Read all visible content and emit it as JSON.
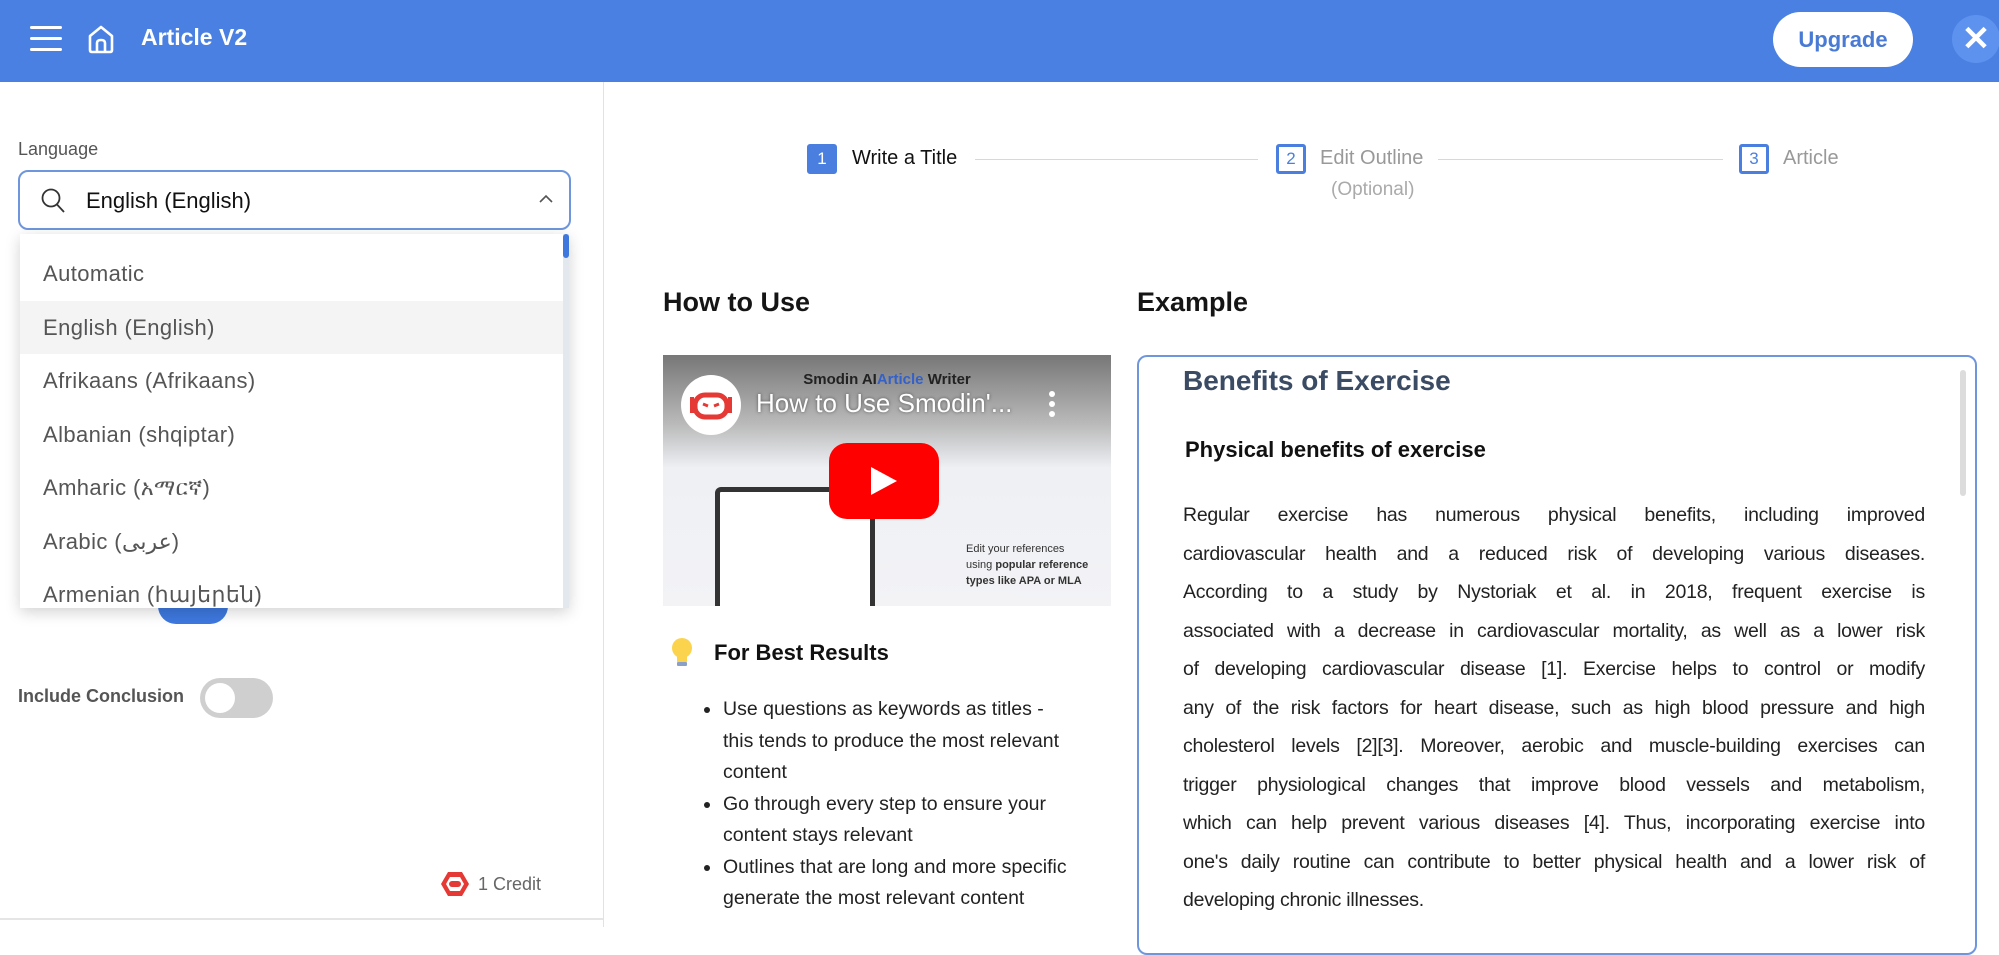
{
  "header": {
    "title": "Article V2",
    "upgrade_label": "Upgrade",
    "brand_color": "#4a80e2"
  },
  "sidebar": {
    "language_label": "Language",
    "language_value": "English (English)",
    "language_options": [
      "Automatic",
      "English (English)",
      "Afrikaans (Afrikaans)",
      "Albanian (shqiptar)",
      "Amharic (አማርኛ)",
      "Arabic (عربى)",
      "Armenian (հայերեն)"
    ],
    "selected_option": "English (English)",
    "include_conclusion_label": "Include Conclusion",
    "include_conclusion_on": false,
    "credit_label": "1 Credit"
  },
  "steps": [
    {
      "num": "1",
      "label": "Write a Title",
      "active": true
    },
    {
      "num": "2",
      "label": "Edit Outline",
      "sub": "(Optional)",
      "active": false
    },
    {
      "num": "3",
      "label": "Article",
      "active": false
    }
  ],
  "how_to_use": {
    "heading": "How to Use",
    "video": {
      "title": "How to Use Smodin'...",
      "banner_prefix": "Smodin AI",
      "banner_highlight": "Article",
      "banner_suffix": " Writer",
      "side_text_1": "Edit your references",
      "side_text_2": "using ",
      "side_text_bold": "popular reference types like APA or MLA"
    },
    "tips_title": "For Best Results",
    "tips": [
      [
        "Use questions as keywords as titles -",
        "this tends to produce the most relevant",
        "content"
      ],
      [
        "Go through every step to ensure your",
        "content stays relevant"
      ],
      [
        "Outlines that are long and more specific",
        "generate the most relevant content"
      ]
    ]
  },
  "example": {
    "heading": "Example",
    "title": "Benefits of Exercise",
    "subtitle": "Physical benefits of exercise",
    "paragraph_lines": [
      "Regular exercise has numerous physical benefits, including improved",
      "cardiovascular health and a reduced risk of developing various diseases.",
      "According to a study by Nystoriak et al. in 2018, frequent exercise is",
      "associated with a decrease in cardiovascular mortality, as well as a lower risk",
      "of developing cardiovascular disease [1]. Exercise helps to control or modify",
      "any of the risk factors for heart disease, such as high blood pressure and high",
      "cholesterol levels [2][3]. Moreover, aerobic and muscle-building exercises can",
      "trigger physiological changes that improve blood vessels and metabolism,",
      "which can help prevent various diseases [4]. Thus, incorporating exercise into",
      "one's daily routine can contribute to better physical health and a lower risk of",
      "developing chronic illnesses."
    ]
  }
}
